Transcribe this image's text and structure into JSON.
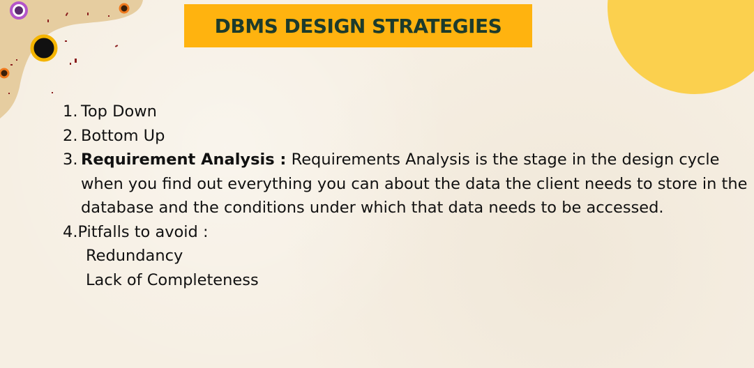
{
  "title": "DBMS DESIGN STRATEGIES",
  "items": [
    {
      "number": "1.",
      "text": "Top Down"
    },
    {
      "number": "2.",
      "text": "Bottom Up"
    },
    {
      "number": "3.",
      "bold_label": "Requirement Analysis :",
      "text": " Requirements Analysis is the stage in the design cycle when you find out everything you can about the data the client needs to store in the database and the conditions under which that data needs to be accessed."
    },
    {
      "number": "4.",
      "text": "Pitfalls to avoid :"
    }
  ],
  "pitfalls": [
    "Redundancy",
    "Lack of Completeness"
  ],
  "colors": {
    "background": "#f6efe3",
    "title_banner": "#ffb30f",
    "title_text": "#1c3b2c",
    "corner_blob": "#fbd04e",
    "left_blob": "#e6cda0",
    "purple_ring": "#b455c9",
    "orange_ring": "#f07a1e",
    "yellow_ring": "#f4b400"
  }
}
